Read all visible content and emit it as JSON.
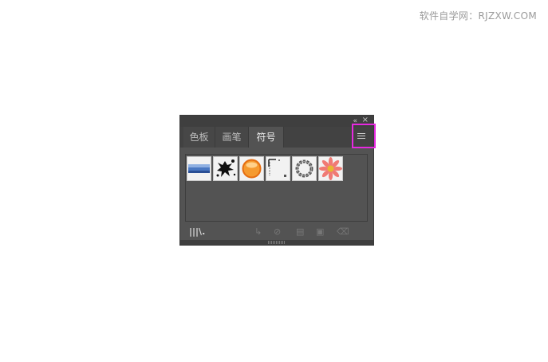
{
  "watermark": "软件自学网：RJZXW.COM",
  "panel": {
    "collapse_icon": "double-chevron-left-icon",
    "close_icon": "close-icon",
    "tabs": [
      {
        "label": "色板",
        "active": false
      },
      {
        "label": "画笔",
        "active": false
      },
      {
        "label": "符号",
        "active": true
      }
    ],
    "menu_icon": "hamburger-menu-icon",
    "highlight_color": "#e629e0",
    "symbols": [
      "blue-banner-symbol",
      "ink-splat-symbol",
      "orange-button-symbol",
      "corner-frame-symbol",
      "ring-symbol",
      "pink-flower-symbol"
    ],
    "toolbar": [
      "symbol-libraries-icon",
      "place-symbol-icon",
      "break-link-icon",
      "symbol-options-icon",
      "new-symbol-icon",
      "delete-icon"
    ]
  }
}
